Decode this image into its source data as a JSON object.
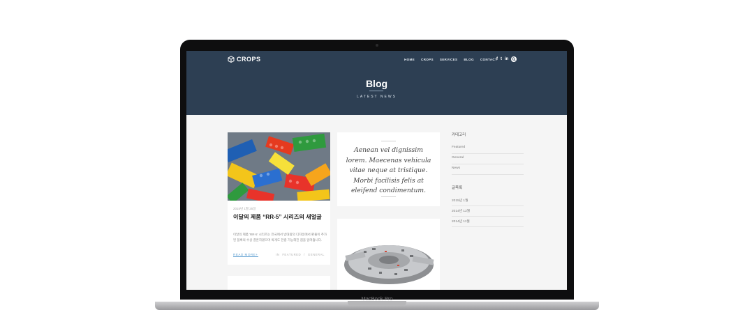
{
  "device": {
    "label": "MacBook Pro"
  },
  "header": {
    "logo_text": "CROPS",
    "nav": [
      "HOME",
      "CROPS",
      "SERVICES",
      "BLOG",
      "CONTACT"
    ],
    "social": [
      "f",
      "t",
      "in"
    ]
  },
  "hero": {
    "title": "Blog",
    "subtitle": "LATEST NEWS"
  },
  "posts": [
    {
      "date": "2015년 1월 25일",
      "title": "이달의 제품 “RR-5” 시리즈의 새얼굴",
      "excerpt": "이달의 제품 'RR-5' 시리즈는 전국에서 방대량의 디자일에서 판출이 추가된 블록의 수상 결혼하였으며 박게도 한층 가능해진 점을 알려줍니다.",
      "read_more": "READ MORE+",
      "tags_prefix": "IN",
      "tags": [
        "FEATURED",
        "/",
        "GENERAL"
      ]
    }
  ],
  "quote": {
    "text": "Aenean vel dignissim lorem. Maecenas vehicula vitae neque at tristique. Morbi facilisis felis at eleifend condimentum."
  },
  "sidebar": {
    "categories_title": "카테고리",
    "categories": [
      "Featured",
      "General",
      "News"
    ],
    "archive_title": "글목록",
    "archive": [
      "2015년 1월",
      "2014년 12월",
      "2014년 11월"
    ]
  },
  "colors": {
    "hero_bg": "#2d3f53",
    "page_bg": "#f5f5f5",
    "link": "#5f9fd1"
  },
  "icons": [
    "cube-logo-icon",
    "facebook-icon",
    "twitter-icon",
    "linkedin-icon",
    "search-icon"
  ]
}
